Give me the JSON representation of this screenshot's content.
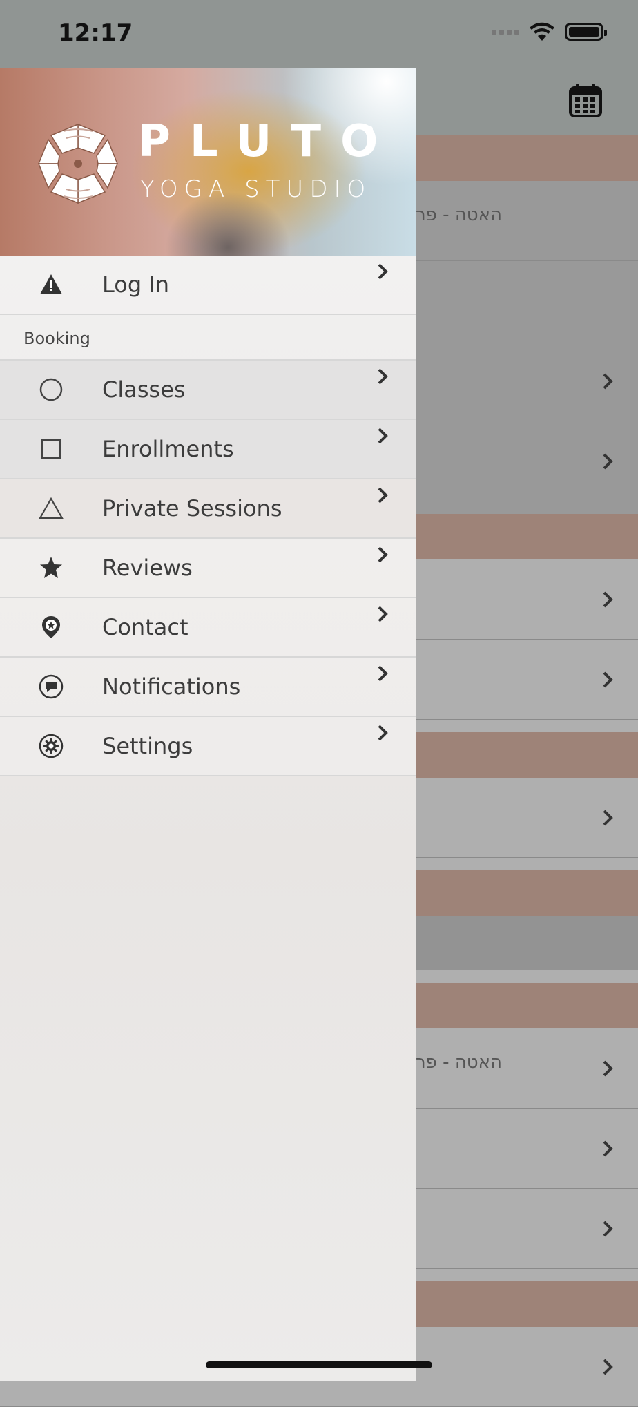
{
  "status_bar": {
    "time": "12:17"
  },
  "drawer": {
    "brand": {
      "name": "PLUTO",
      "subtitle": "YOGA STUDIO"
    },
    "login": {
      "label": "Log In",
      "icon": "warning-icon"
    },
    "section_booking": "Booking",
    "items": [
      {
        "label": "Classes",
        "icon": "circle-icon"
      },
      {
        "label": "Enrollments",
        "icon": "square-icon"
      },
      {
        "label": "Private Sessions",
        "icon": "triangle-icon"
      },
      {
        "label": "Reviews",
        "icon": "star-icon"
      },
      {
        "label": "Contact",
        "icon": "location-pin-icon"
      },
      {
        "label": "Notifications",
        "icon": "chat-bubble-icon"
      },
      {
        "label": "Settings",
        "icon": "gear-icon"
      }
    ]
  },
  "background": {
    "row_text_1": "האטה - פר",
    "row_text_2": "האטה - פר"
  },
  "colors": {
    "section_band": "#9e8378",
    "drawer_bg": "#eceae9",
    "text": "#3c3c3c"
  }
}
